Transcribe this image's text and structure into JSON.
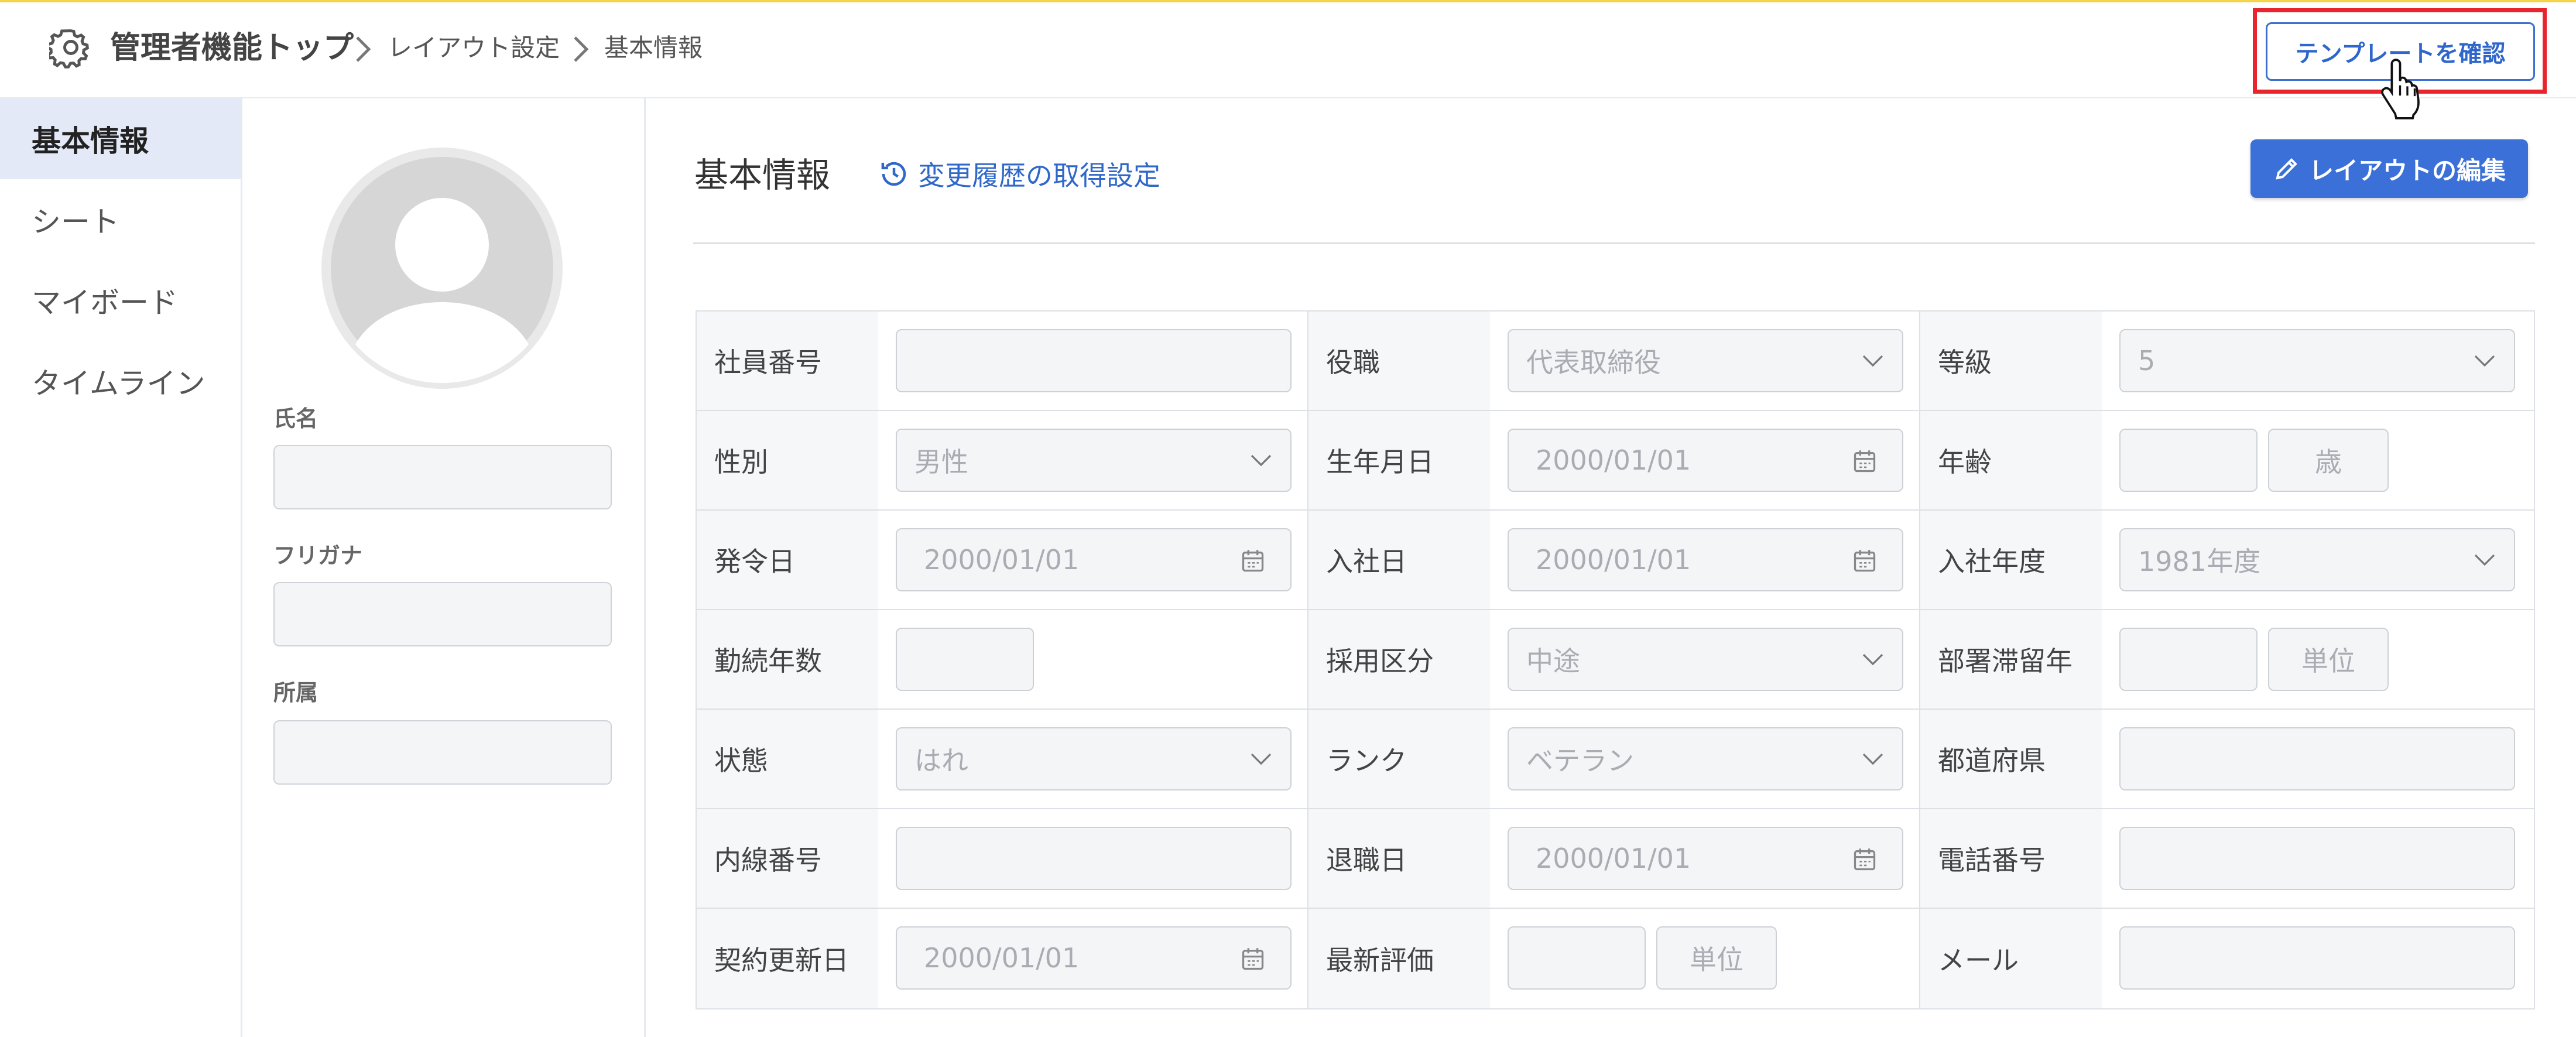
{
  "header": {
    "breadcrumb_root": "管理者機能トップ",
    "breadcrumb_mid": "レイアウト設定",
    "breadcrumb_current": "基本情報",
    "confirm_template_button": "テンプレートを確認"
  },
  "sidebar": {
    "items": [
      {
        "label": "基本情報",
        "active": true
      },
      {
        "label": "シート",
        "active": false
      },
      {
        "label": "マイボード",
        "active": false
      },
      {
        "label": "タイムライン",
        "active": false
      }
    ]
  },
  "profile": {
    "name_label": "氏名",
    "furigana_label": "フリガナ",
    "affiliation_label": "所属"
  },
  "main": {
    "title": "基本情報",
    "history_link": "変更履歴の取得設定",
    "edit_layout_button": "レイアウトの編集"
  },
  "grid": {
    "rows": [
      [
        {
          "label": "社員番号",
          "type": "text",
          "value": ""
        },
        {
          "label": "役職",
          "type": "select",
          "value": "代表取締役"
        },
        {
          "label": "等級",
          "type": "select",
          "value": "5"
        }
      ],
      [
        {
          "label": "性別",
          "type": "select",
          "value": "男性"
        },
        {
          "label": "生年月日",
          "type": "date",
          "value": "2000/01/01"
        },
        {
          "label": "年齢",
          "type": "num-unit",
          "value": "",
          "unit": "歳"
        }
      ],
      [
        {
          "label": "発令日",
          "type": "date",
          "value": "2000/01/01"
        },
        {
          "label": "入社日",
          "type": "date",
          "value": "2000/01/01"
        },
        {
          "label": "入社年度",
          "type": "select",
          "value": "1981年度"
        }
      ],
      [
        {
          "label": "勤続年数",
          "type": "num",
          "value": ""
        },
        {
          "label": "採用区分",
          "type": "select",
          "value": "中途"
        },
        {
          "label": "部署滞留年",
          "type": "num-unit",
          "value": "",
          "unit": "単位"
        }
      ],
      [
        {
          "label": "状態",
          "type": "select",
          "value": "はれ"
        },
        {
          "label": "ランク",
          "type": "select",
          "value": "ベテラン"
        },
        {
          "label": "都道府県",
          "type": "text",
          "value": ""
        }
      ],
      [
        {
          "label": "内線番号",
          "type": "text",
          "value": ""
        },
        {
          "label": "退職日",
          "type": "date",
          "value": "2000/01/01"
        },
        {
          "label": "電話番号",
          "type": "text",
          "value": ""
        }
      ],
      [
        {
          "label": "契約更新日",
          "type": "date",
          "value": "2000/01/01"
        },
        {
          "label": "最新評価",
          "type": "num-unit",
          "value": "",
          "unit": "単位"
        },
        {
          "label": "メール",
          "type": "text",
          "value": ""
        }
      ]
    ]
  },
  "colors": {
    "accent": "#3b70d8",
    "link": "#3068c9",
    "highlight": "#e8242c",
    "sidebar_active": "#e3e9f7",
    "top_line": "#f4d24a"
  },
  "icons": {
    "settings": "gear-icon",
    "history": "history-icon",
    "edit": "pencil-icon",
    "dropdown": "chevron-down-icon",
    "date": "calendar-icon",
    "cursor": "hand-pointer-icon"
  }
}
